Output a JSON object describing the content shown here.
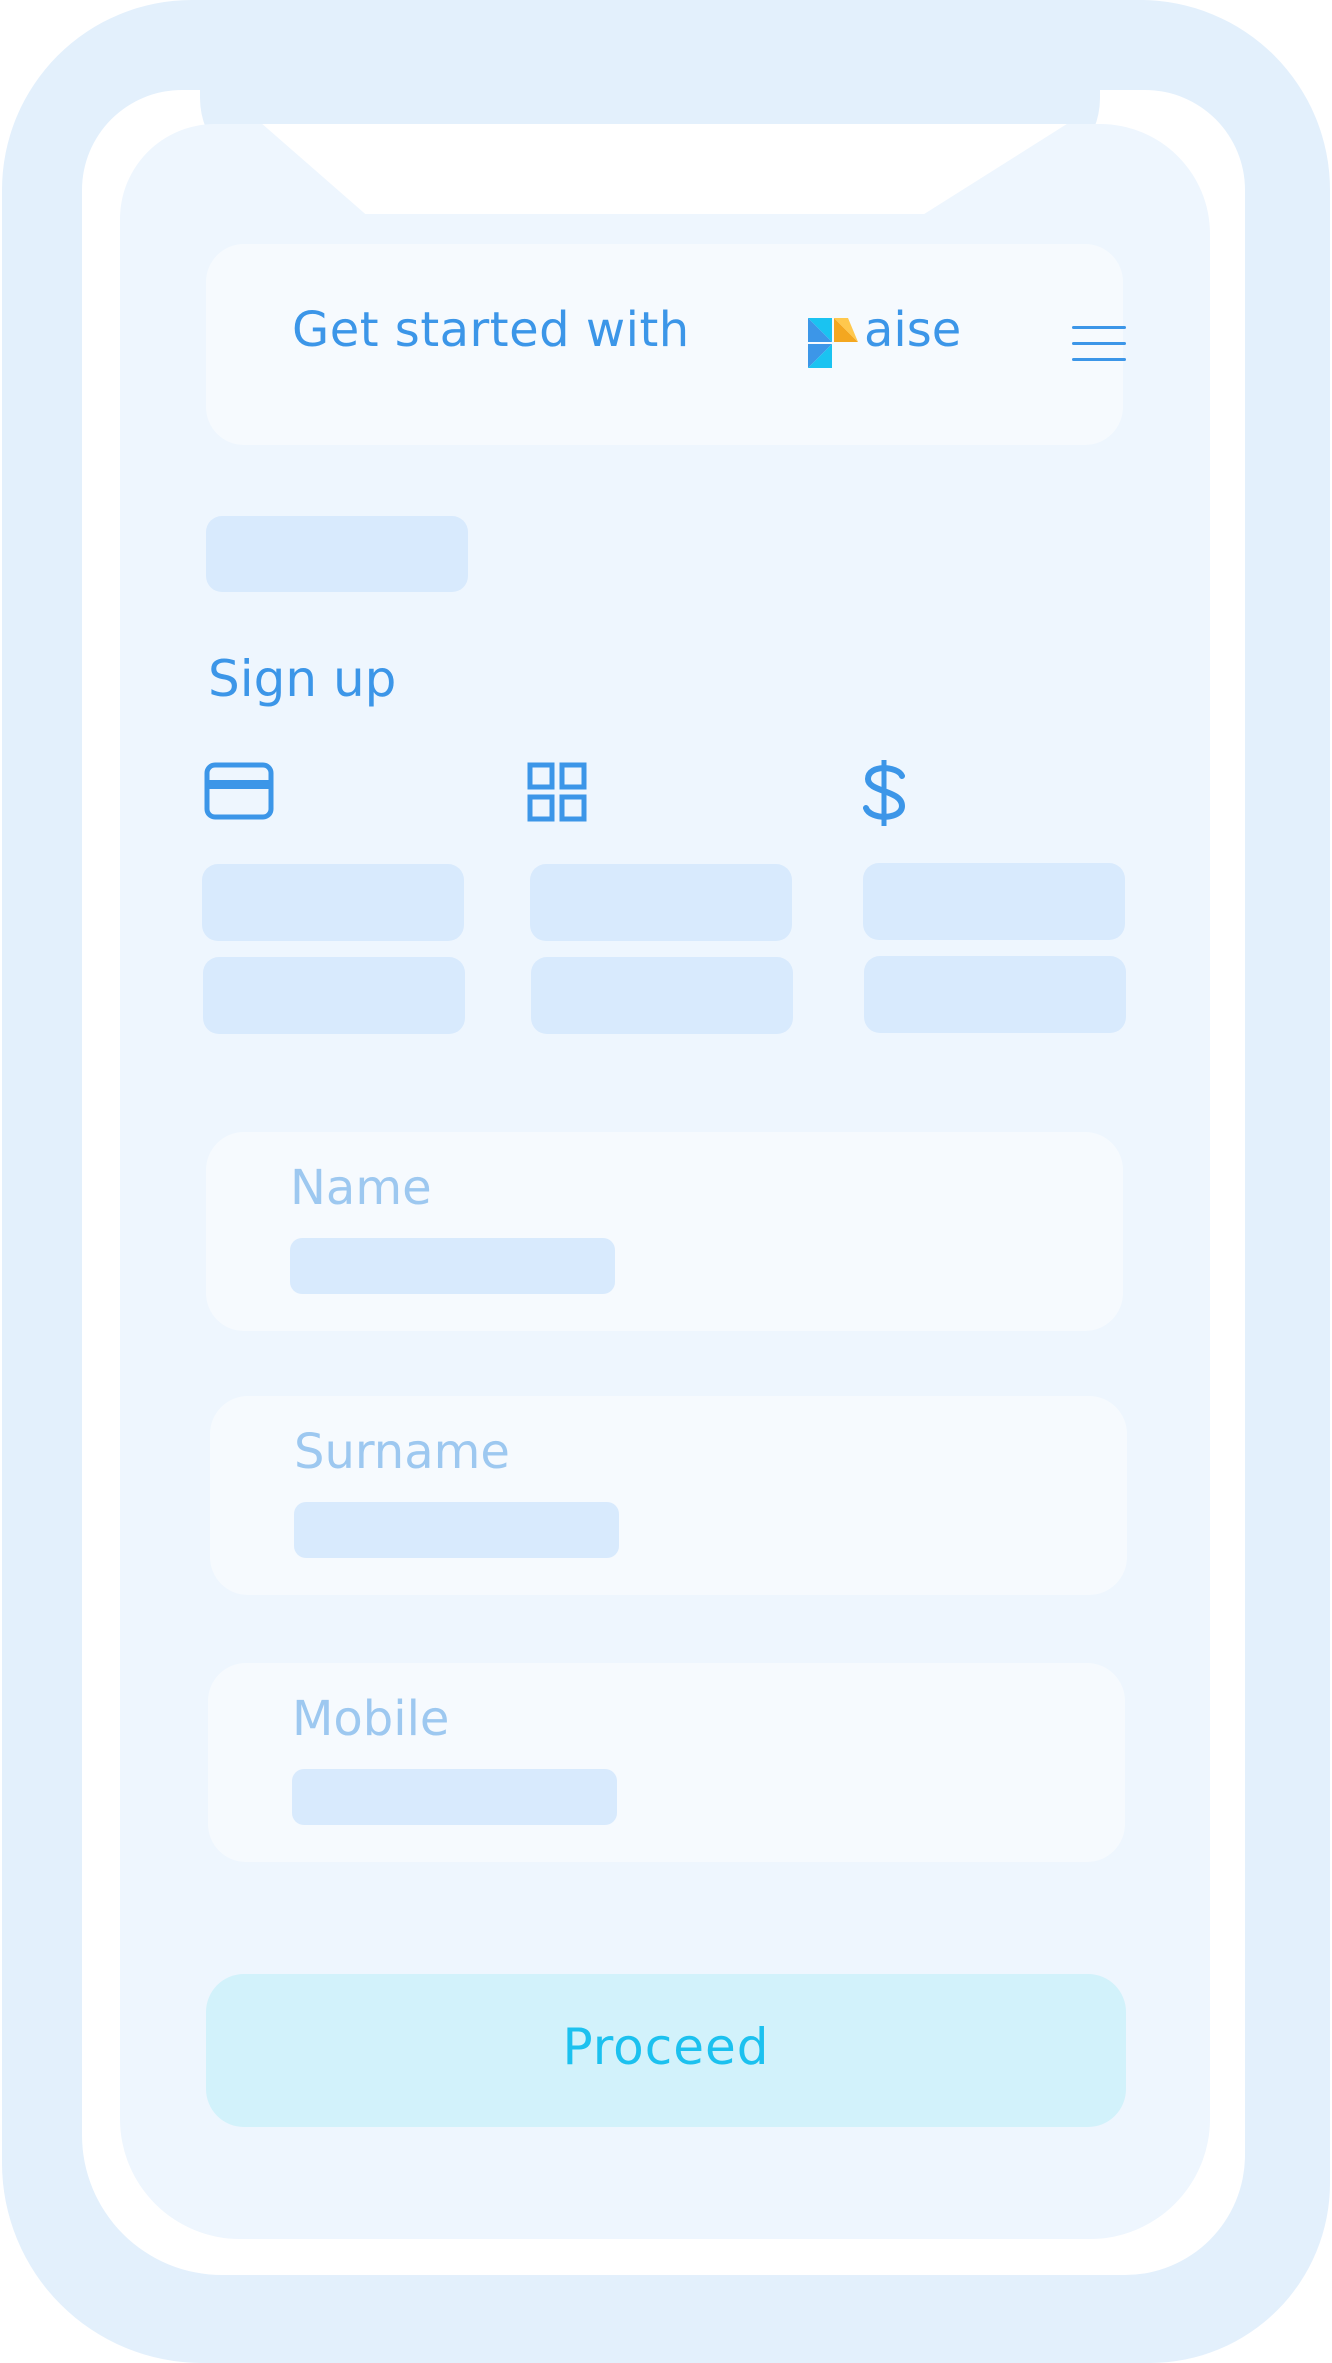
{
  "header": {
    "title": "Get started with",
    "brand_suffix": "aise"
  },
  "signup": {
    "title": "Sign up",
    "options": [
      {
        "icon": "credit-card-icon"
      },
      {
        "icon": "grid-icon"
      },
      {
        "icon": "dollar-icon"
      }
    ]
  },
  "form": {
    "fields": [
      {
        "label": "Name"
      },
      {
        "label": "Surname"
      },
      {
        "label": "Mobile"
      }
    ],
    "proceed_label": "Proceed"
  },
  "colors": {
    "primary": "#3c96e8",
    "brand_yellow": "#f4a720",
    "brand_cyan": "#1ac3f1",
    "placeholder": "#d8eafd",
    "button_bg": "#d2f2fb",
    "button_text": "#1cc1ef"
  }
}
